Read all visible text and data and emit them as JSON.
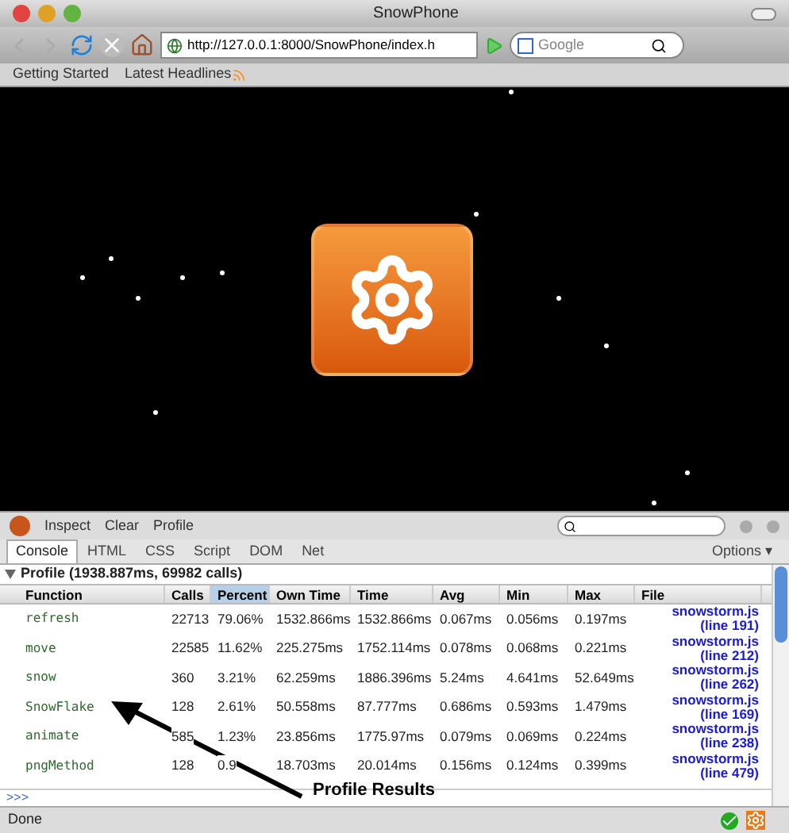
{
  "window": {
    "title": "SnowPhone"
  },
  "toolbar": {
    "url": "http://127.0.0.1:8000/SnowPhone/index.h",
    "search_placeholder": "Google"
  },
  "bookmarks": [
    "Getting Started",
    "Latest Headlines"
  ],
  "firebug": {
    "actions": [
      "Inspect",
      "Clear",
      "Profile"
    ],
    "tabs": [
      {
        "label": "Console",
        "selected": true
      },
      {
        "label": "HTML",
        "selected": false
      },
      {
        "label": "CSS",
        "selected": false
      },
      {
        "label": "Script",
        "selected": false
      },
      {
        "label": "DOM",
        "selected": false
      },
      {
        "label": "Net",
        "selected": false
      }
    ],
    "options": "Options ▾",
    "profile_title": "Profile (1938.887ms, 69982 calls)",
    "table": {
      "columns": [
        {
          "label": "Function",
          "selected": false
        },
        {
          "label": "Calls",
          "selected": false
        },
        {
          "label": "Percent",
          "selected": true
        },
        {
          "label": "Own Time",
          "selected": false
        },
        {
          "label": "Time",
          "selected": false
        },
        {
          "label": "Avg",
          "selected": false
        },
        {
          "label": "Min",
          "selected": false
        },
        {
          "label": "Max",
          "selected": false
        },
        {
          "label": "File",
          "selected": false
        }
      ],
      "rows": [
        {
          "cells": [
            "refresh",
            "22713",
            "79.06%",
            "1532.866ms",
            "1532.866ms",
            "0.067ms",
            "0.056ms",
            "0.197ms"
          ],
          "file": "snowstorm.js",
          "line": "(line 191)"
        },
        {
          "cells": [
            "move",
            "22585",
            "11.62%",
            "225.275ms",
            "1752.114ms",
            "0.078ms",
            "0.068ms",
            "0.221ms"
          ],
          "file": "snowstorm.js",
          "line": "(line 212)"
        },
        {
          "cells": [
            "snow",
            "360",
            "3.21%",
            "62.259ms",
            "1886.396ms",
            "5.24ms",
            "4.641ms",
            "52.649ms"
          ],
          "file": "snowstorm.js",
          "line": "(line 262)"
        },
        {
          "cells": [
            "SnowFlake",
            "128",
            "2.61%",
            "50.558ms",
            "87.777ms",
            "0.686ms",
            "0.593ms",
            "1.479ms"
          ],
          "file": "snowstorm.js",
          "line": "(line 169)"
        },
        {
          "cells": [
            "animate",
            "585",
            "1.23%",
            "23.856ms",
            "1775.97ms",
            "0.079ms",
            "0.069ms",
            "0.224ms"
          ],
          "file": "snowstorm.js",
          "line": "(line 238)"
        },
        {
          "cells": [
            "pngMethod",
            "128",
            "0.9",
            "18.703ms",
            "20.014ms",
            "0.156ms",
            "0.124ms",
            "0.399ms"
          ],
          "file": "snowstorm.js",
          "line": "(line 479)"
        }
      ]
    },
    "command_prompt": ">>>"
  },
  "annotation": "Profile Results",
  "status_bar": {
    "text": "Done"
  }
}
